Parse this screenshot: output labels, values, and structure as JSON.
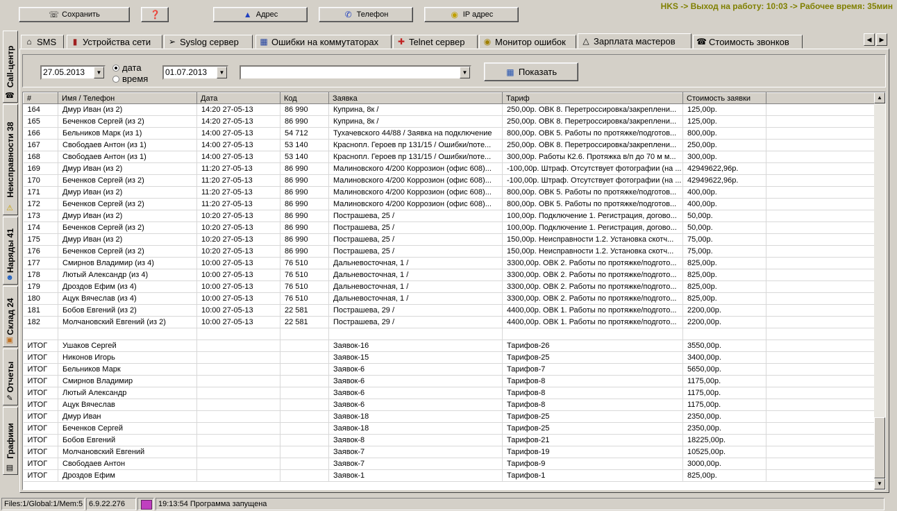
{
  "toolbar": {
    "save_label": "Сохранить",
    "address_label": "Адрес",
    "phone_label": "Телефон",
    "ip_label": "IP адрес"
  },
  "status_top": "HKS -> Выход на работу: 10:03 -> Рабочее время: 35мин",
  "side_tabs": [
    {
      "label": "Call-центр"
    },
    {
      "label": "Неисправности 38"
    },
    {
      "label": "Наряды 41"
    },
    {
      "label": "Склад 24"
    },
    {
      "label": "Отчеты"
    },
    {
      "label": "Графики"
    }
  ],
  "tabs": [
    {
      "label": "SMS"
    },
    {
      "label": "Устройства сети"
    },
    {
      "label": "Syslog сервер"
    },
    {
      "label": "Ошибки на коммутаторах"
    },
    {
      "label": "Telnet сервер"
    },
    {
      "label": "Монитор ошибок"
    },
    {
      "label": "Зарплата мастеров"
    },
    {
      "label": "Стоимость звонков"
    }
  ],
  "filter": {
    "date_from": "27.05.2013",
    "date_to": "01.07.2013",
    "radio_date": "дата",
    "radio_time": "время",
    "selected_mode": "дата",
    "master_value": "",
    "show_label": "Показать"
  },
  "grid": {
    "columns": [
      "#",
      "Имя / Телефон",
      "Дата",
      "Код",
      "Заявка",
      "Тариф",
      "Стоимость заявки"
    ],
    "rows": [
      [
        "164",
        "Дмур Иван (из 2)",
        "14:20 27-05-13",
        "86 990",
        "Куприна, 8к /",
        "250,00р. ОВК 8. Перетроссировка/закреплени...",
        "125,00р."
      ],
      [
        "165",
        "Беченков Сергей (из 2)",
        "14:20 27-05-13",
        "86 990",
        "Куприна, 8к /",
        "250,00р. ОВК 8. Перетроссировка/закреплени...",
        "125,00р."
      ],
      [
        "166",
        "Бельников Марк (из 1)",
        "14:00 27-05-13",
        "54 712",
        "Тухачевского 44/88 / Заявка на подключение",
        "800,00р. ОВК 5. Работы по протяжке/подготов...",
        "800,00р."
      ],
      [
        "167",
        "Свободаев Антон (из 1)",
        "14:00 27-05-13",
        "53 140",
        "Краснопл. Героев пр 131/15 / Ошибки/поте...",
        "250,00р. ОВК 8. Перетроссировка/закреплени...",
        "250,00р."
      ],
      [
        "168",
        "Свободаев Антон (из 1)",
        "14:00 27-05-13",
        "53 140",
        "Краснопл. Героев пр 131/15 / Ошибки/поте...",
        "300,00р. Работы К2.6. Протяжка в/п до 70 м м...",
        "300,00р."
      ],
      [
        "169",
        "Дмур Иван (из 2)",
        "11:20 27-05-13",
        "86 990",
        "Малиновского 4/200 Коррозион (офис 608)...",
        "-100,00р. Штраф. Отсутствует фотографии (на ...",
        "42949622,96р."
      ],
      [
        "170",
        "Беченков Сергей (из 2)",
        "11:20 27-05-13",
        "86 990",
        "Малиновского 4/200 Коррозион (офис 608)...",
        "-100,00р. Штраф. Отсутствует фотографии (на ...",
        "42949622,96р."
      ],
      [
        "171",
        "Дмур Иван (из 2)",
        "11:20 27-05-13",
        "86 990",
        "Малиновского 4/200 Коррозион (офис 608)...",
        "800,00р. ОВК 5. Работы по протяжке/подготов...",
        "400,00р."
      ],
      [
        "172",
        "Беченков Сергей (из 2)",
        "11:20 27-05-13",
        "86 990",
        "Малиновского 4/200 Коррозион (офис 608)...",
        "800,00р. ОВК 5. Работы по протяжке/подготов...",
        "400,00р."
      ],
      [
        "173",
        "Дмур Иван (из 2)",
        "10:20 27-05-13",
        "86 990",
        "Пострашева, 25 /",
        "100,00р. Подключение 1. Регистрация, догово...",
        "50,00р."
      ],
      [
        "174",
        "Беченков Сергей (из 2)",
        "10:20 27-05-13",
        "86 990",
        "Пострашева, 25 /",
        "100,00р. Подключение 1. Регистрация, догово...",
        "50,00р."
      ],
      [
        "175",
        "Дмур Иван (из 2)",
        "10:20 27-05-13",
        "86 990",
        "Пострашева, 25 /",
        "150,00р. Неисправности 1.2. Установка скотч...",
        "75,00р."
      ],
      [
        "176",
        "Беченков Сергей (из 2)",
        "10:20 27-05-13",
        "86 990",
        "Пострашева, 25 /",
        "150,00р. Неисправности 1.2. Установка скотч...",
        "75,00р."
      ],
      [
        "177",
        "Смирнов Владимир (из 4)",
        "10:00 27-05-13",
        "76 510",
        "Дальневосточная, 1 /",
        "3300,00р. ОВК 2. Работы по протяжке/подгото...",
        "825,00р."
      ],
      [
        "178",
        "Лютый Александр (из 4)",
        "10:00 27-05-13",
        "76 510",
        "Дальневосточная, 1 /",
        "3300,00р. ОВК 2. Работы по протяжке/подгото...",
        "825,00р."
      ],
      [
        "179",
        "Дроздов Ефим (из 4)",
        "10:00 27-05-13",
        "76 510",
        "Дальневосточная, 1 /",
        "3300,00р. ОВК 2. Работы по протяжке/подгото...",
        "825,00р."
      ],
      [
        "180",
        "Ацук Вячеслав (из 4)",
        "10:00 27-05-13",
        "76 510",
        "Дальневосточная, 1 /",
        "3300,00р. ОВК 2. Работы по протяжке/подгото...",
        "825,00р."
      ],
      [
        "181",
        "Бобов Евгений (из 2)",
        "10:00 27-05-13",
        "22 581",
        "Пострашева, 29 /",
        "4400,00р. ОВК 1. Работы по протяжке/подгото...",
        "2200,00р."
      ],
      [
        "182",
        "Молчановский Евгений (из 2)",
        "10:00 27-05-13",
        "22 581",
        "Пострашева, 29 /",
        "4400,00р. ОВК 1. Работы по протяжке/подгото...",
        "2200,00р."
      ],
      [
        "",
        "",
        "",
        "",
        "",
        "",
        ""
      ],
      [
        "ИТОГ",
        "Ушаков Сергей",
        "",
        "",
        "Заявок-16",
        "Тарифов-26",
        "3550,00р."
      ],
      [
        "ИТОГ",
        "Никонов Игорь",
        "",
        "",
        "Заявок-15",
        "Тарифов-25",
        "3400,00р."
      ],
      [
        "ИТОГ",
        "Бельников Марк",
        "",
        "",
        "Заявок-6",
        "Тарифов-7",
        "5650,00р."
      ],
      [
        "ИТОГ",
        "Смирнов Владимир",
        "",
        "",
        "Заявок-6",
        "Тарифов-8",
        "1175,00р."
      ],
      [
        "ИТОГ",
        "Лютый Александр",
        "",
        "",
        "Заявок-6",
        "Тарифов-8",
        "1175,00р."
      ],
      [
        "ИТОГ",
        "Ацук Вячеслав",
        "",
        "",
        "Заявок-6",
        "Тарифов-8",
        "1175,00р."
      ],
      [
        "ИТОГ",
        "Дмур Иван",
        "",
        "",
        "Заявок-18",
        "Тарифов-25",
        "2350,00р."
      ],
      [
        "ИТОГ",
        "Беченков Сергей",
        "",
        "",
        "Заявок-18",
        "Тарифов-25",
        "2350,00р."
      ],
      [
        "ИТОГ",
        "Бобов Евгений",
        "",
        "",
        "Заявок-8",
        "Тарифов-21",
        "18225,00р."
      ],
      [
        "ИТОГ",
        "Молчановский Евгений",
        "",
        "",
        "Заявок-7",
        "Тарифов-19",
        "10525,00р."
      ],
      [
        "ИТОГ",
        "Свободаев Антон",
        "",
        "",
        "Заявок-7",
        "Тарифов-9",
        "3000,00р."
      ],
      [
        "ИТОГ",
        "Дроздов Ефим",
        "",
        "",
        "Заявок-1",
        "Тарифов-1",
        "825,00р."
      ]
    ]
  },
  "statusbar": {
    "files": "Files:1/Global:1/Mem:5",
    "version": "6.9.22.276",
    "message": "19:13:54 Программа запущена"
  },
  "colors": {
    "face": "#d4d0c8",
    "status_top": "#808000",
    "grid_bg": "#ffffff"
  }
}
